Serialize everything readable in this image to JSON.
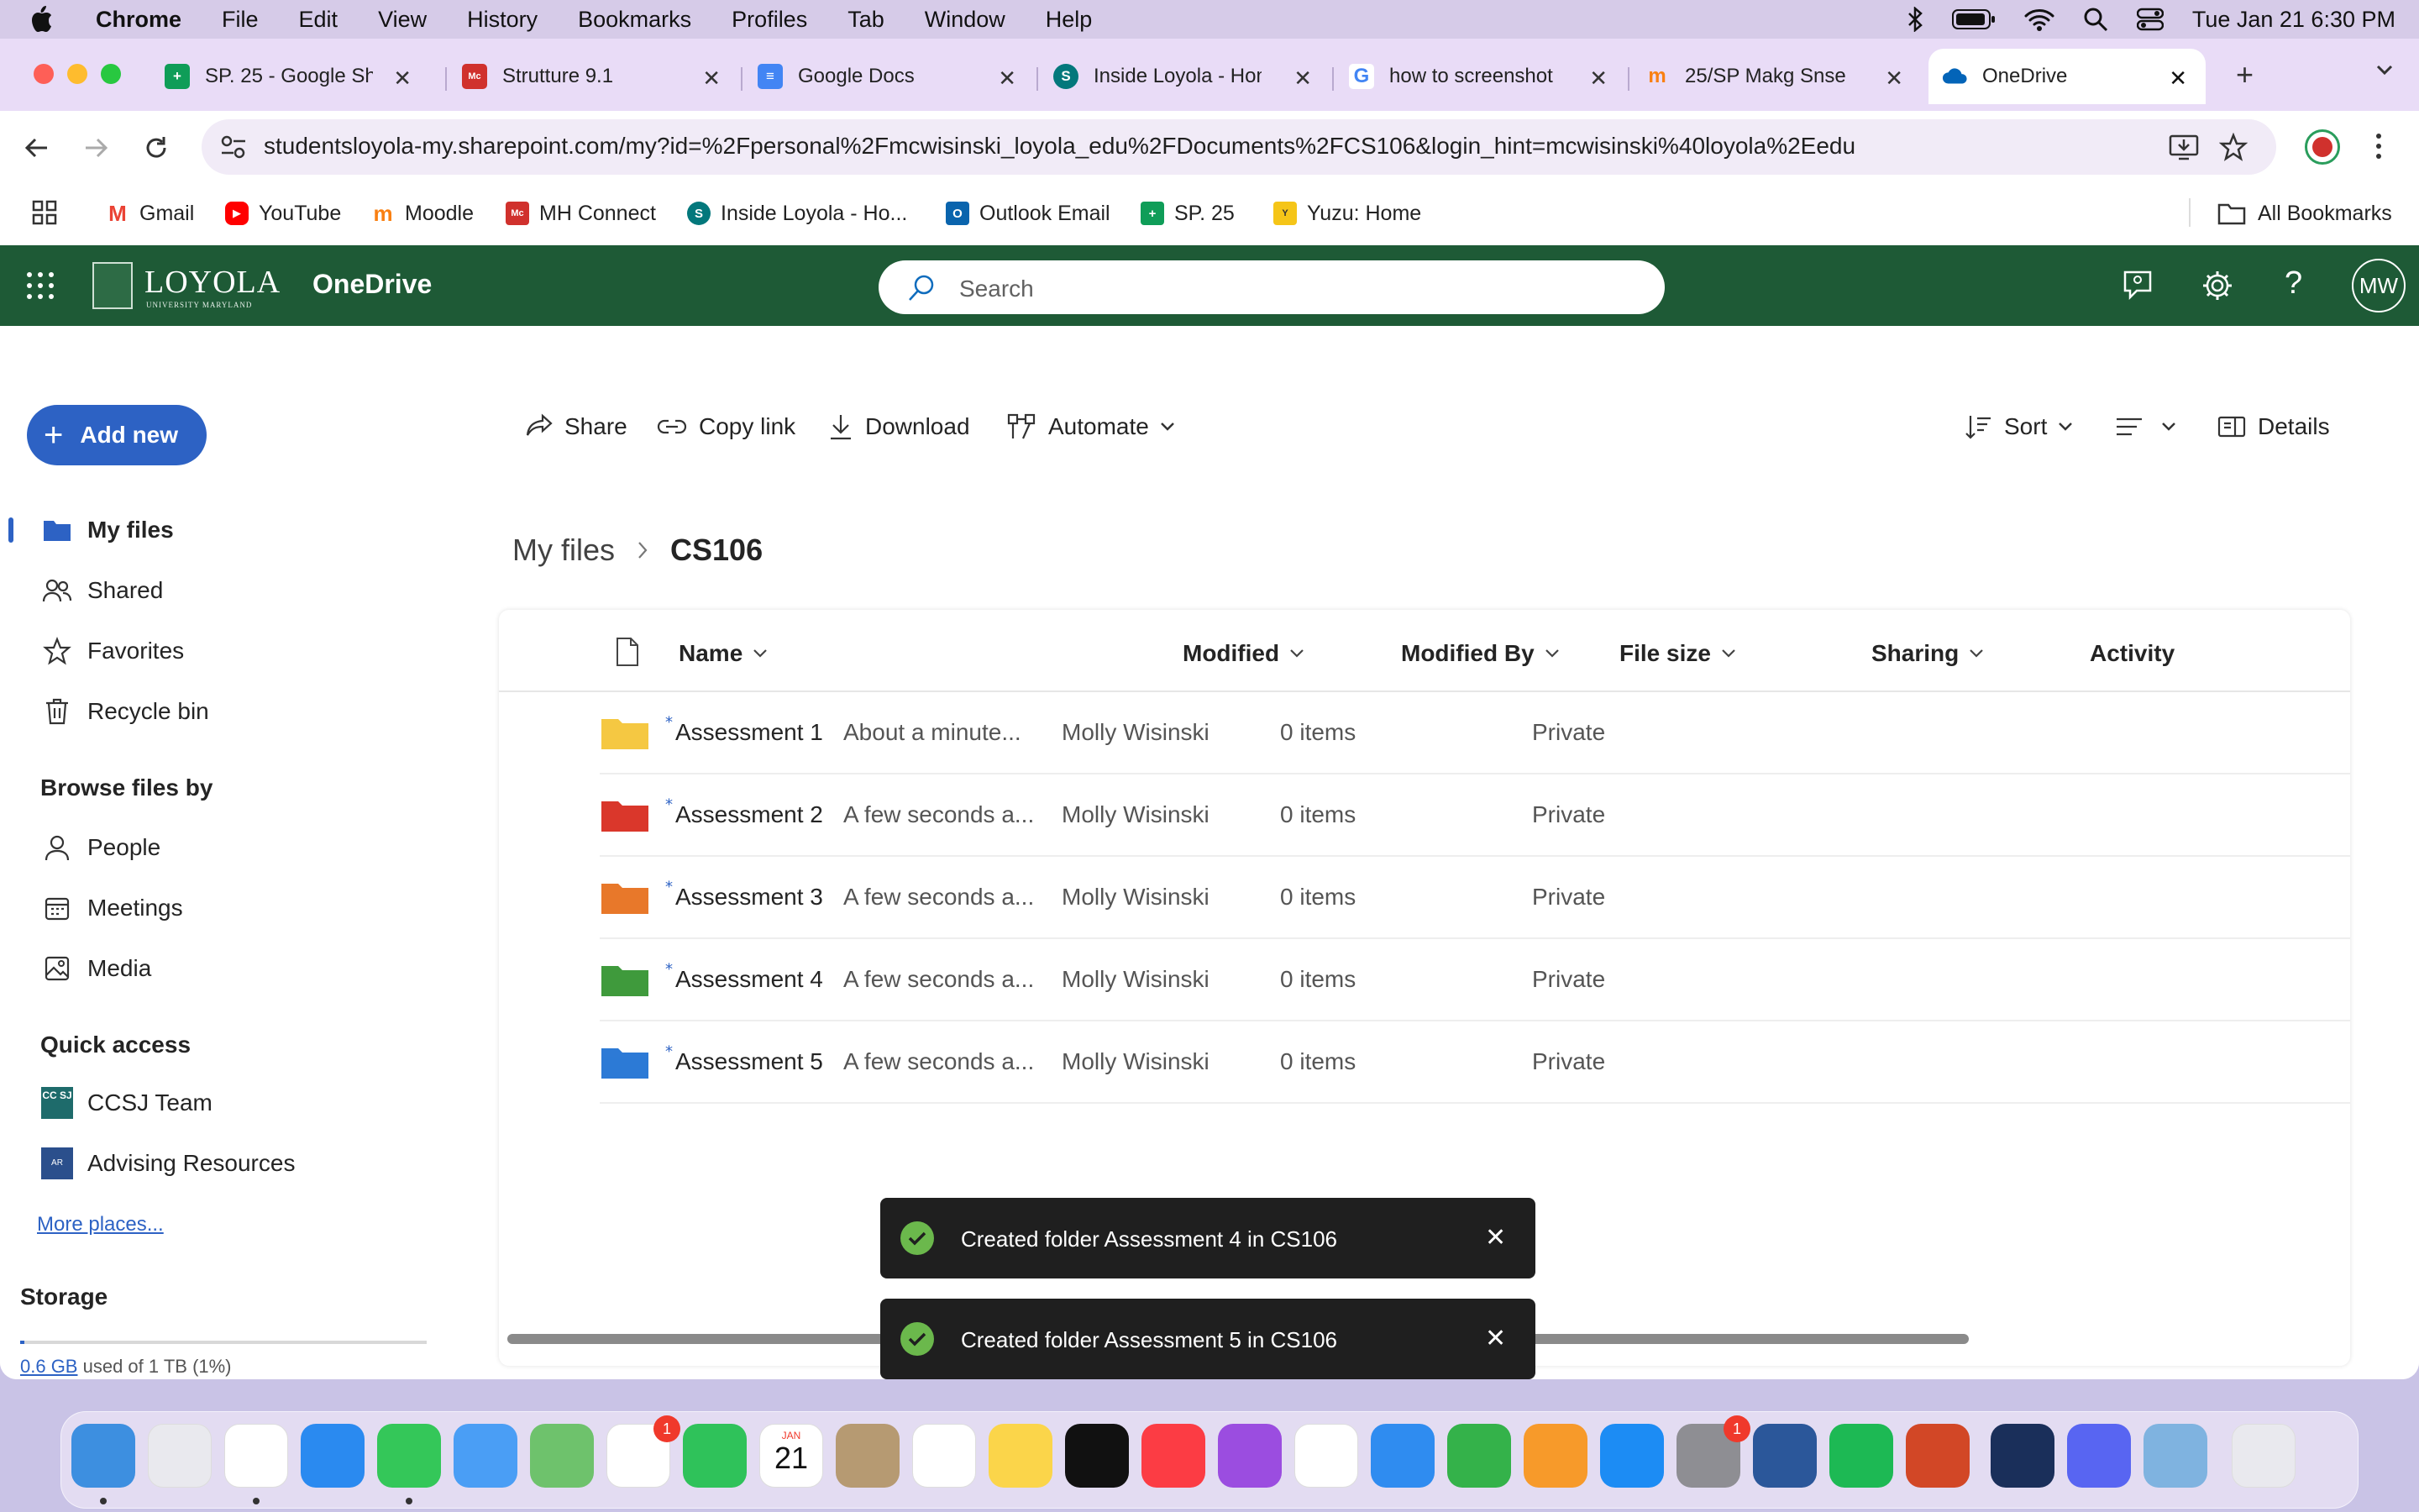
{
  "menubar": {
    "app_name": "Chrome",
    "items": [
      "File",
      "Edit",
      "View",
      "History",
      "Bookmarks",
      "Profiles",
      "Tab",
      "Window",
      "Help"
    ],
    "datetime": "Tue Jan 21  6:30 PM"
  },
  "tabs": [
    {
      "title": "SP. 25 - Google Sh",
      "icon": "google-sheets-icon",
      "color": "#0f9d58"
    },
    {
      "title": "Strutture 9.1",
      "icon": "mcgraw-hill-icon",
      "color": "#d0312d"
    },
    {
      "title": "Google Docs",
      "icon": "google-docs-icon",
      "color": "#4285f4"
    },
    {
      "title": "Inside Loyola - Hom",
      "icon": "sharepoint-icon",
      "color": "#03787c"
    },
    {
      "title": "how to screenshot",
      "icon": "google-icon",
      "color": "#ffffff"
    },
    {
      "title": "25/SP Makg Snse |",
      "icon": "moodle-icon",
      "color": "#f98012"
    },
    {
      "title": "OneDrive",
      "icon": "onedrive-icon",
      "color": "#0364b8",
      "active": true
    }
  ],
  "address": {
    "url": "studentsloyola-my.sharepoint.com/my?id=%2Fpersonal%2Fmcwisinski_loyola_edu%2FDocuments%2FCS106&login_hint=mcwisinski%40loyola%2Eedu"
  },
  "bookmarks": {
    "items": [
      {
        "label": "Gmail",
        "color": "#ea4335"
      },
      {
        "label": "YouTube",
        "color": "#ff0000"
      },
      {
        "label": "Moodle",
        "color": "#f98012"
      },
      {
        "label": "MH Connect",
        "color": "#d0312d"
      },
      {
        "label": "Inside Loyola - Ho...",
        "color": "#03787c"
      },
      {
        "label": "Outlook Email",
        "color": "#0a64ad"
      },
      {
        "label": "SP. 25",
        "color": "#0f9d58"
      },
      {
        "label": "Yuzu: Home",
        "color": "#f5c518"
      }
    ],
    "all_label": "All Bookmarks"
  },
  "onedrive": {
    "brand": "LOYOLA",
    "brand_sub": "UNIVERSITY MARYLAND",
    "app_name": "OneDrive",
    "search_placeholder": "Search",
    "avatar": "MW",
    "header_color": "#1e5a36"
  },
  "sidebar": {
    "add_new": "Add new",
    "nav": [
      "My files",
      "Shared",
      "Favorites",
      "Recycle bin"
    ],
    "browse_heading": "Browse files by",
    "browse": [
      "People",
      "Meetings",
      "Media"
    ],
    "quick_heading": "Quick access",
    "quick": [
      {
        "label": "CCSJ Team",
        "badge": "CC SJ"
      },
      {
        "label": "Advising Resources",
        "badge": "AR"
      }
    ],
    "more_places": "More places...",
    "storage_heading": "Storage",
    "storage_used": "0.6 GB",
    "storage_rest": "used of 1 TB (1%)",
    "storage_fraction": 0.01
  },
  "commandbar": {
    "share": "Share",
    "copy_link": "Copy link",
    "download": "Download",
    "automate": "Automate",
    "sort": "Sort",
    "details": "Details"
  },
  "breadcrumb": {
    "root": "My files",
    "current": "CS106"
  },
  "table": {
    "columns": [
      "Name",
      "Modified",
      "Modified By",
      "File size",
      "Sharing",
      "Activity"
    ],
    "rows": [
      {
        "name": "Assessment 1",
        "modified": "About a minute...",
        "by": "Molly Wisinski",
        "size": "0 items",
        "sharing": "Private",
        "color": "#f5c842"
      },
      {
        "name": "Assessment 2",
        "modified": "A few seconds a...",
        "by": "Molly Wisinski",
        "size": "0 items",
        "sharing": "Private",
        "color": "#d9372b"
      },
      {
        "name": "Assessment 3",
        "modified": "A few seconds a...",
        "by": "Molly Wisinski",
        "size": "0 items",
        "sharing": "Private",
        "color": "#e8782a"
      },
      {
        "name": "Assessment 4",
        "modified": "A few seconds a...",
        "by": "Molly Wisinski",
        "size": "0 items",
        "sharing": "Private",
        "color": "#3f9a3c"
      },
      {
        "name": "Assessment 5",
        "modified": "A few seconds a...",
        "by": "Molly Wisinski",
        "size": "0 items",
        "sharing": "Private",
        "color": "#2d7ad6"
      }
    ]
  },
  "toasts": [
    {
      "text": "Created folder Assessment 4 in CS106"
    },
    {
      "text": "Created folder Assessment 5 in CS106"
    }
  ],
  "dock": {
    "apps": [
      {
        "icon": "finder-icon",
        "color": "#3d8fe0"
      },
      {
        "icon": "launchpad-icon",
        "color": "#e9e9ee"
      },
      {
        "icon": "chrome-icon",
        "color": "#ffffff"
      },
      {
        "icon": "safari-icon",
        "color": "#2a8af0"
      },
      {
        "icon": "messages-icon",
        "color": "#34c759"
      },
      {
        "icon": "mail-icon",
        "color": "#4a9ef5"
      },
      {
        "icon": "maps-icon",
        "color": "#6ec26c"
      },
      {
        "icon": "photos-icon",
        "color": "#ffffff",
        "badge": "1"
      },
      {
        "icon": "facetime-icon",
        "color": "#2fc25a"
      },
      {
        "icon": "calendar-icon",
        "color": "#ffffff",
        "text": "21",
        "sub": "JAN"
      },
      {
        "icon": "contacts-icon",
        "color": "#b69a72"
      },
      {
        "icon": "reminders-icon",
        "color": "#ffffff"
      },
      {
        "icon": "notes-icon",
        "color": "#fbd54a"
      },
      {
        "icon": "appletv-icon",
        "color": "#111111"
      },
      {
        "icon": "music-icon",
        "color": "#fc3c44"
      },
      {
        "icon": "podcasts-icon",
        "color": "#9b4de0"
      },
      {
        "icon": "news-icon",
        "color": "#ffffff"
      },
      {
        "icon": "keynote-icon",
        "color": "#2f8cf0"
      },
      {
        "icon": "numbers-icon",
        "color": "#34b24a"
      },
      {
        "icon": "pages-icon",
        "color": "#f79a2a"
      },
      {
        "icon": "appstore-icon",
        "color": "#1c8cf4"
      },
      {
        "icon": "system-settings-icon",
        "color": "#8e8e93",
        "badge": "1"
      },
      {
        "icon": "word-icon",
        "color": "#2b579a"
      },
      {
        "icon": "spotify-icon",
        "color": "#1db954"
      },
      {
        "icon": "powerpoint-icon",
        "color": "#d24726"
      },
      {
        "icon": "remarkable-icon",
        "color": "#1a2f5a"
      },
      {
        "icon": "discord-icon",
        "color": "#5865f2"
      },
      {
        "icon": "preview-icon",
        "color": "#7fb3e0"
      },
      {
        "icon": "trash-icon",
        "color": "#e9e9ee"
      }
    ]
  }
}
